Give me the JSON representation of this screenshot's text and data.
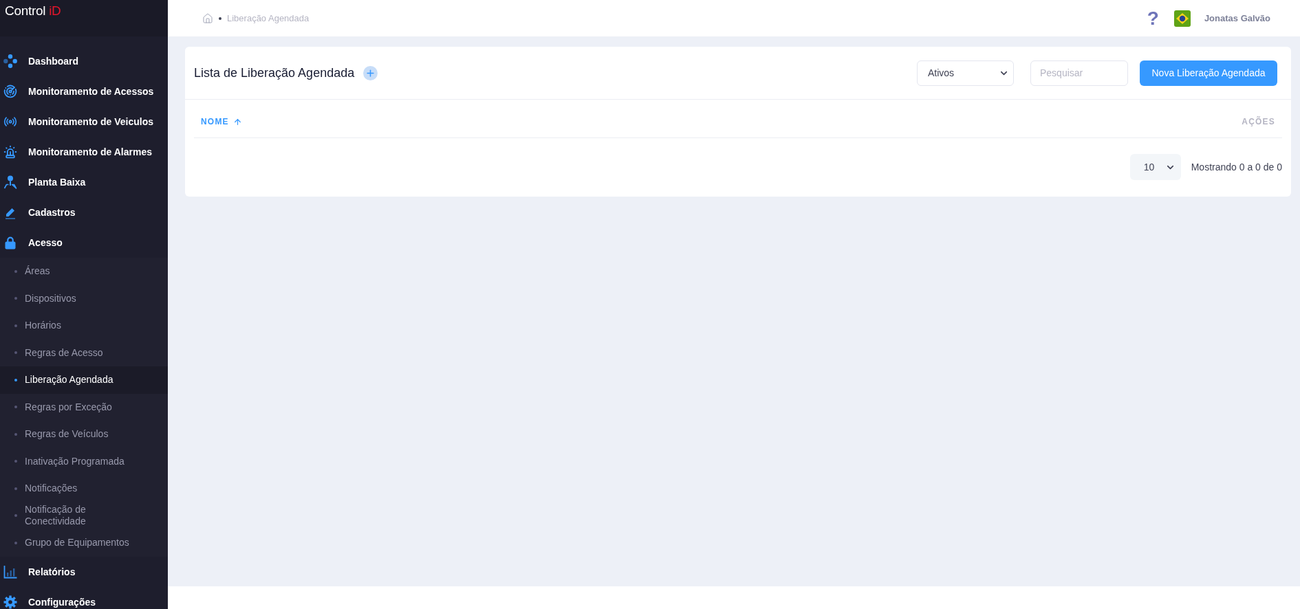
{
  "logo": {
    "text": "Control",
    "accent": "iD"
  },
  "sidebar": {
    "items": [
      {
        "label": "Dashboard"
      },
      {
        "label": "Monitoramento de Acessos"
      },
      {
        "label": "Monitoramento de Veiculos"
      },
      {
        "label": "Monitoramento de Alarmes"
      },
      {
        "label": "Planta Baixa"
      },
      {
        "label": "Cadastros"
      },
      {
        "label": "Acesso",
        "children": [
          {
            "label": "Áreas",
            "selected": false
          },
          {
            "label": "Dispositivos",
            "selected": false
          },
          {
            "label": "Horários",
            "selected": false
          },
          {
            "label": "Regras de Acesso",
            "selected": false
          },
          {
            "label": "Liberação Agendada",
            "selected": true
          },
          {
            "label": "Regras por Exceção",
            "selected": false
          },
          {
            "label": "Regras de Veículos",
            "selected": false
          },
          {
            "label": "Inativação Programada",
            "selected": false
          },
          {
            "label": "Notificações",
            "selected": false
          },
          {
            "label": "Notificação de Conectividade",
            "selected": false
          },
          {
            "label": "Grupo de Equipamentos",
            "selected": false
          }
        ]
      },
      {
        "label": "Relatórios"
      },
      {
        "label": "Configurações"
      }
    ]
  },
  "header": {
    "breadcrumb": [
      "Liberação Agendada"
    ],
    "help": "?",
    "user_name": "Jonatas Galvão"
  },
  "card": {
    "title": "Lista de Liberação Agendada",
    "status_filter": {
      "value": "Ativos"
    },
    "search": {
      "placeholder": "Pesquisar"
    },
    "new_button": "Nova Liberação Agendada",
    "table": {
      "columns": [
        {
          "label": "NOME",
          "sorted": true
        },
        {
          "label": "AÇÕES",
          "sorted": false
        }
      ]
    },
    "pagination": {
      "page_size": "10",
      "summary": "Mostrando 0 a 0 de 0"
    }
  }
}
